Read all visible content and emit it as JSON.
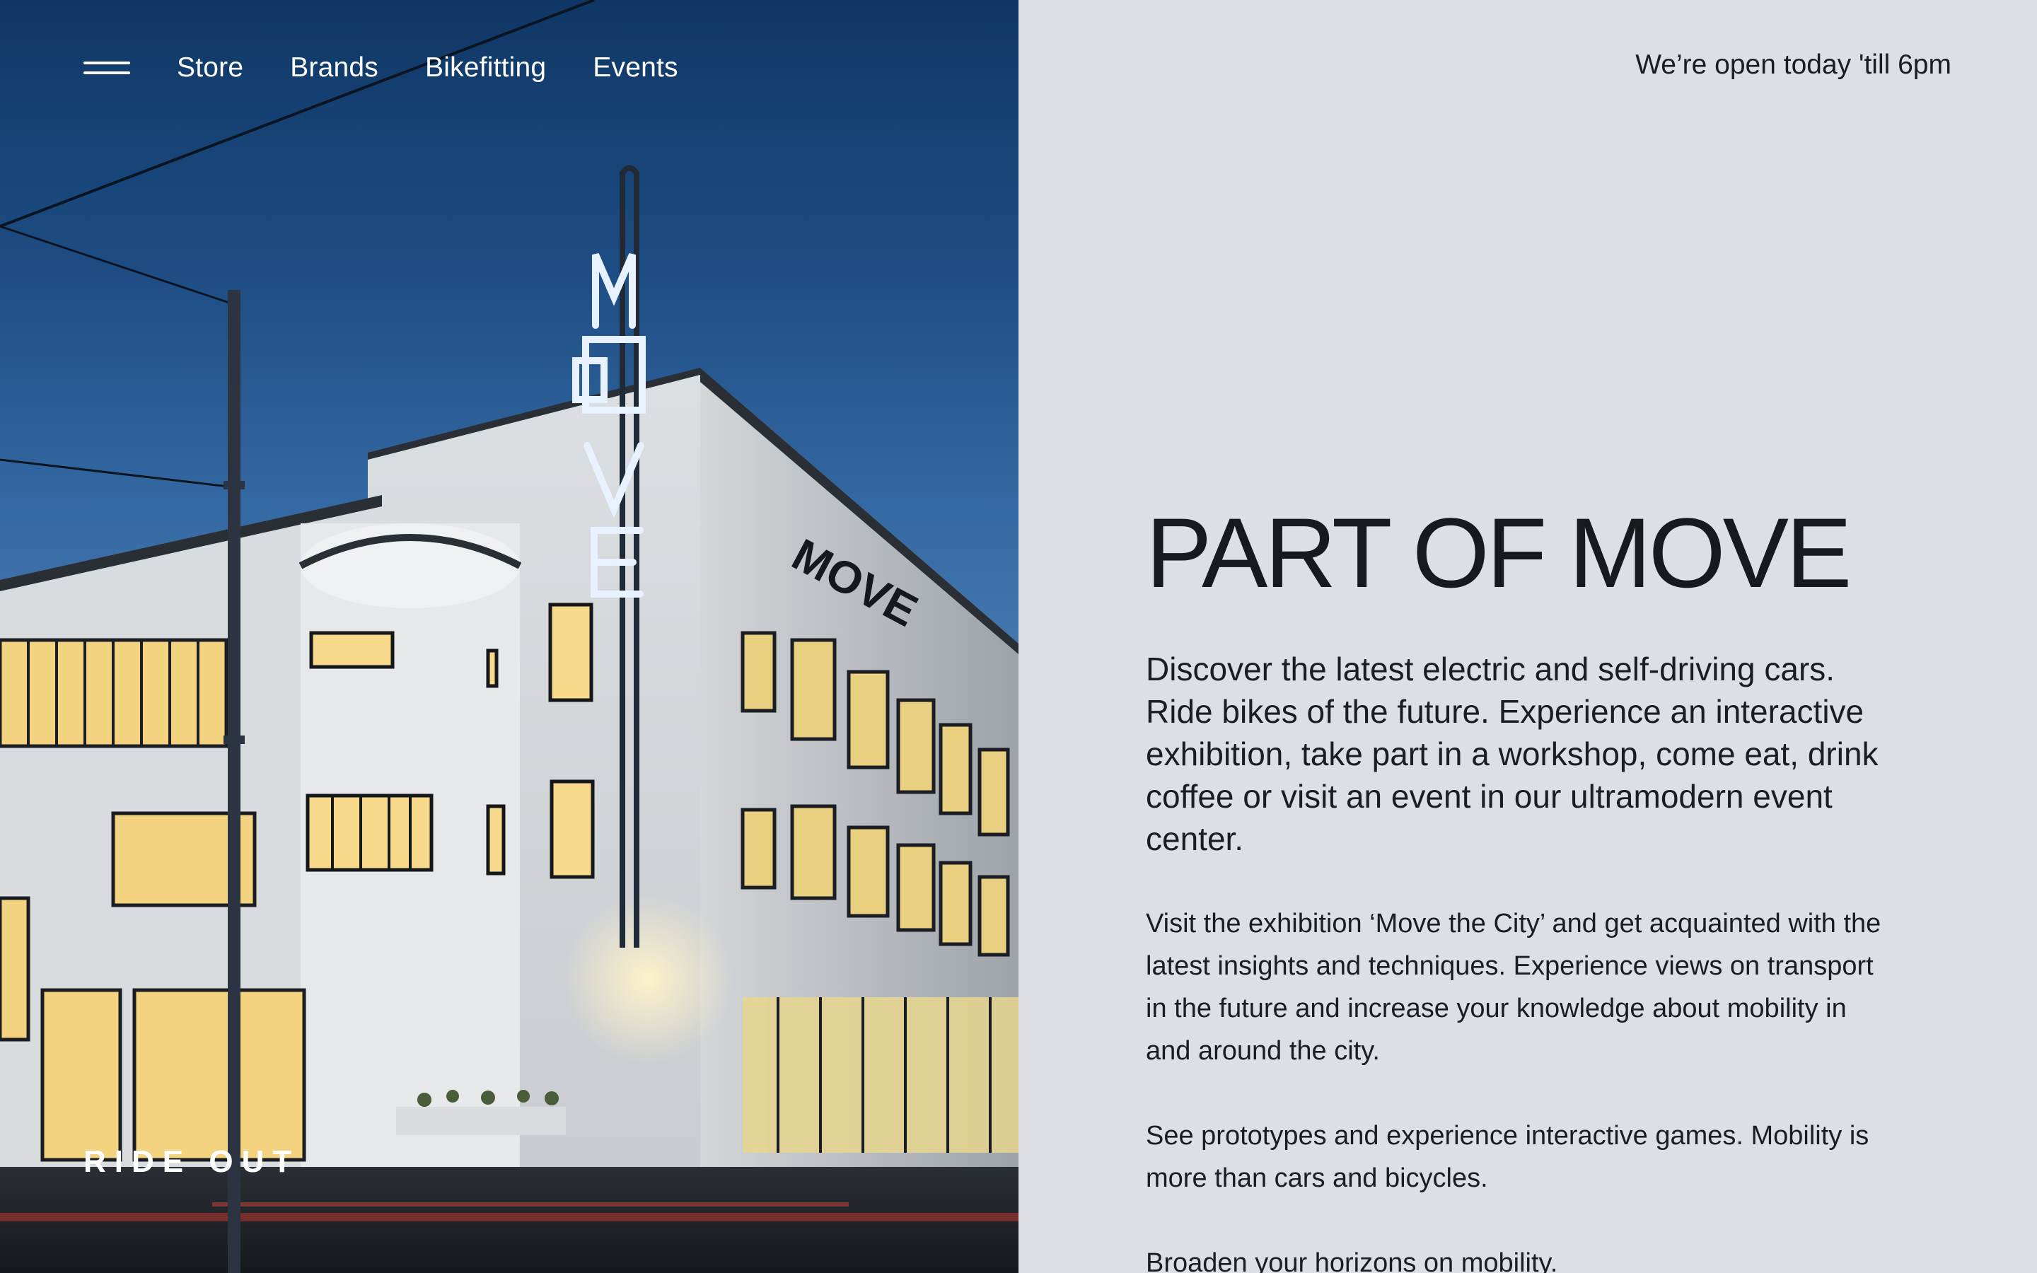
{
  "nav": {
    "menu_icon": "hamburger-menu-icon",
    "links": [
      "Store",
      "Brands",
      "Bikefitting",
      "Events"
    ]
  },
  "hero": {
    "sign_text": "MOVE",
    "building_sign_text": "MOVE",
    "caption": "RIDE OUT"
  },
  "header": {
    "hours": "We’re open today 'till 6pm"
  },
  "main": {
    "title": "PART OF MOVE",
    "intro": "Discover the latest electric and self-driving cars. Ride bikes of the future. Experience an interactive exhibition, take part in a workshop, come eat, drink coffee or visit an event in our ultramodern event center.",
    "paragraphs": [
      "Visit the exhibition ‘Move the City’ and get acquainted with the latest insights and techniques. Experience views on transport in the future and increase your knowledge about mobility in and around the city.",
      "See prototypes and experience interactive games. Mobility is more than cars and bicycles.",
      "Broaden your horizons on mobility."
    ]
  },
  "colors": {
    "content_bg": "#dce0e4",
    "text": "#1b1d20",
    "sky_top": "#0f3765",
    "sky_mid": "#4a7cb2",
    "building": "#e7e9ea",
    "window_glow": "#f6d98a"
  }
}
